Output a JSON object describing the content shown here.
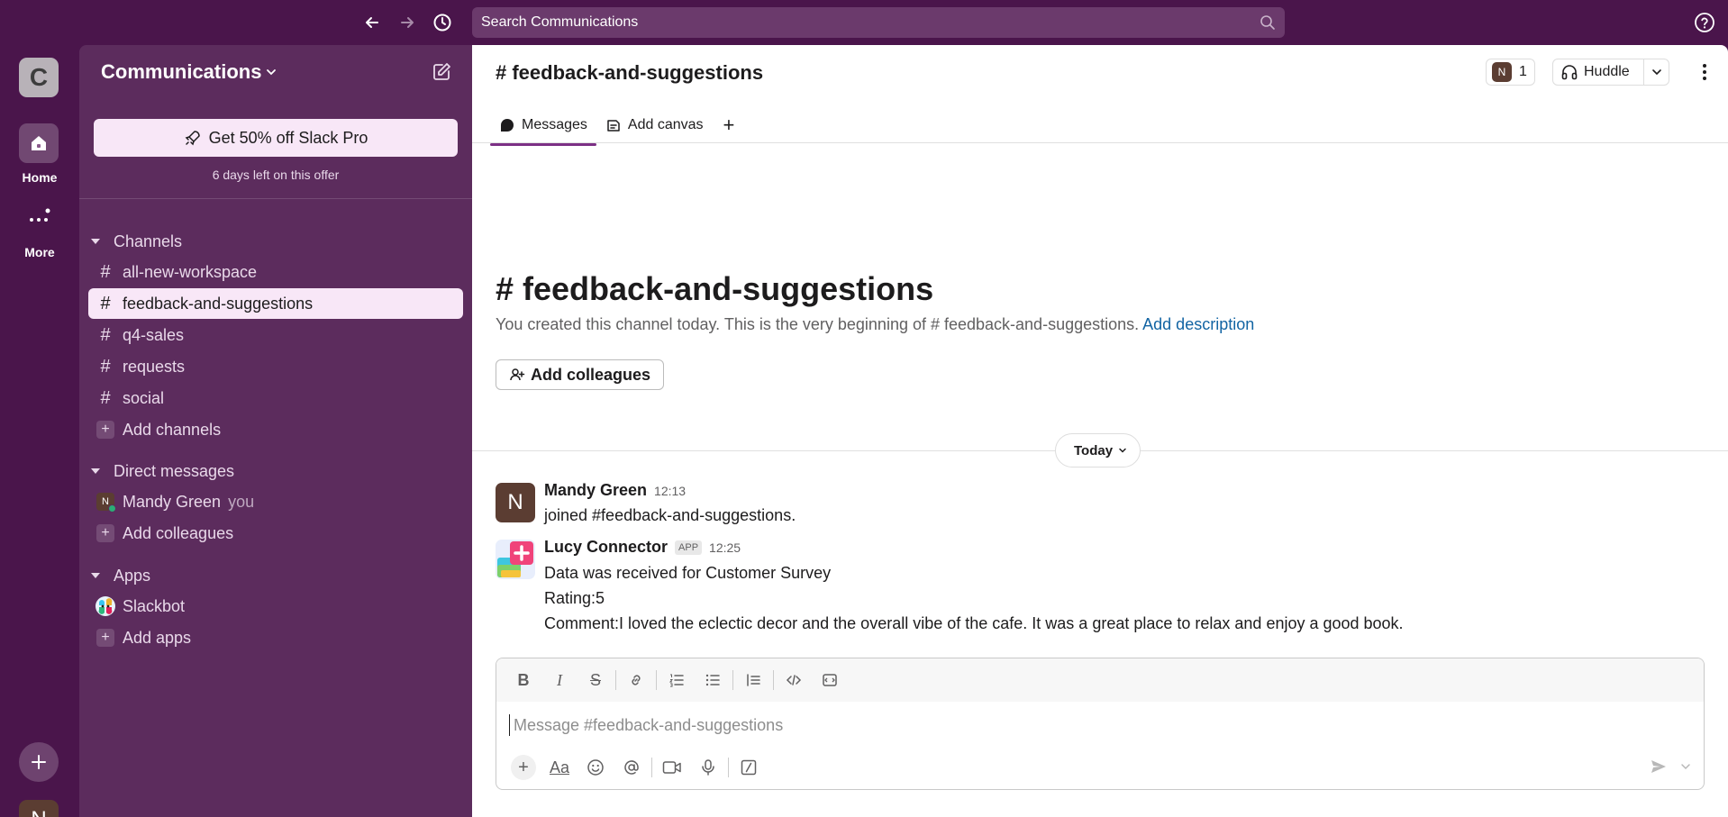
{
  "topbar": {
    "search_placeholder": "Search Communications"
  },
  "rail": {
    "workspace_initial": "C",
    "home_label": "Home",
    "more_label": "More",
    "user_initial": "N"
  },
  "sidebar": {
    "workspace_name": "Communications",
    "promo_label": "Get 50% off Slack Pro",
    "promo_subtext": "6 days left on this offer",
    "channels_header": "Channels",
    "channels": [
      {
        "name": "all-new-workspace"
      },
      {
        "name": "feedback-and-suggestions",
        "active": true
      },
      {
        "name": "q4-sales"
      },
      {
        "name": "requests"
      },
      {
        "name": "social"
      }
    ],
    "add_channels": "Add channels",
    "dm_header": "Direct messages",
    "dm_user": "Mandy Green",
    "dm_you": "you",
    "dm_initial": "N",
    "add_colleagues": "Add colleagues",
    "apps_header": "Apps",
    "app_slackbot": "Slackbot",
    "add_apps": "Add apps"
  },
  "channel": {
    "title": "# feedback-and-suggestions",
    "member_count": "1",
    "member_initial": "N",
    "huddle_label": "Huddle",
    "tabs": {
      "messages": "Messages",
      "add_canvas": "Add canvas",
      "plus": "+"
    },
    "intro_title": "# feedback-and-suggestions",
    "intro_text": "You created this channel today. This is the very beginning of # feedback-and-suggestions.",
    "intro_link": "Add description",
    "add_colleagues_button": "Add colleagues",
    "date_divider": "Today"
  },
  "messages": [
    {
      "author": "Mandy Green",
      "initial": "N",
      "time": "12:13",
      "lines": [
        "joined #feedback-and-suggestions."
      ]
    },
    {
      "author": "Lucy Connector",
      "badge": "APP",
      "time": "12:25",
      "lines": [
        "Data was received for Customer Survey",
        "Rating:5",
        "Comment:I loved the eclectic decor and the overall vibe of the cafe. It was a great place to relax and enjoy a good book."
      ]
    }
  ],
  "composer": {
    "placeholder": "Message #feedback-and-suggestions"
  },
  "colors": {
    "aubergine": "#4a154b",
    "sidebar": "#5c2c5d",
    "active_item": "#f8e7f7",
    "link": "#1264a3",
    "presence": "#2bac76"
  }
}
